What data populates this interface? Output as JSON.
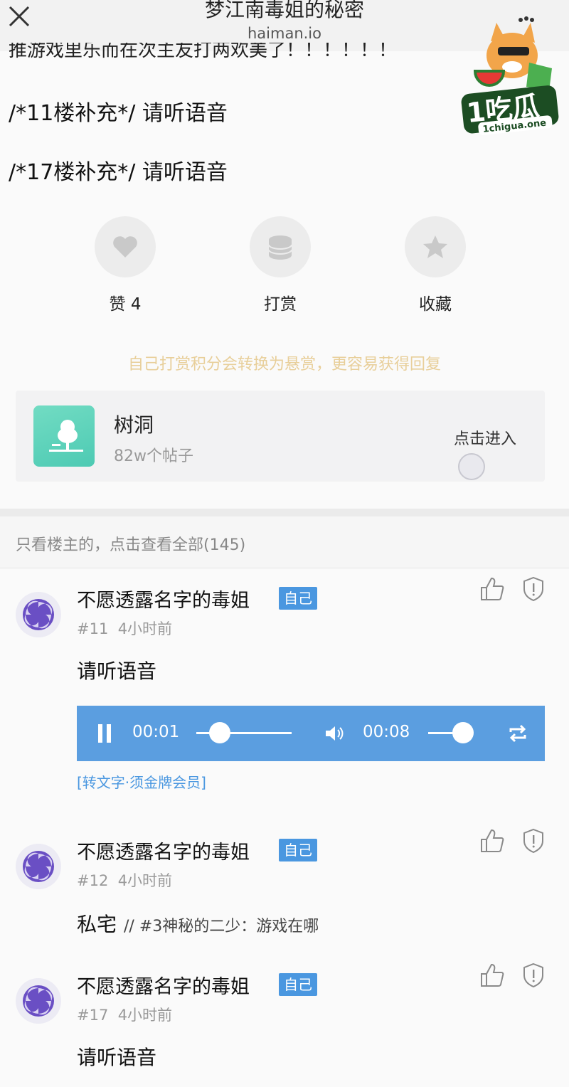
{
  "header": {
    "title": "梦江南毒姐的秘密",
    "domain": "haiman.io",
    "cut_text": "推游戏里乐而在次主友打两欢美了！！！！！！"
  },
  "watermark": {
    "brand": "1吃瓜",
    "site": "1chigua.one"
  },
  "body_lines": [
    "/*11楼补充*/ 请听语音",
    "/*17楼补充*/ 请听语音"
  ],
  "actions": [
    {
      "label": "赞 4",
      "icon": "heart-icon"
    },
    {
      "label": "打赏",
      "icon": "coin-stack-icon"
    },
    {
      "label": "收藏",
      "icon": "star-icon"
    }
  ],
  "reward_hint": "自己打赏积分会转换为悬赏，更容易获得回复",
  "forum_card": {
    "name": "树洞",
    "post_count": "82w个帖子",
    "enter_label": "点击进入",
    "icon": "tree-icon"
  },
  "filter": {
    "text": "只看楼主的，点击查看全部(145)"
  },
  "posts": [
    {
      "username": "不愿透露名字的毒姐",
      "badge": "自己",
      "floor": "#11",
      "time": "4小时前",
      "content": "请听语音",
      "audio": {
        "current": "00:01",
        "duration": "00:08",
        "progress": 0.125,
        "volume": 0.75
      },
      "transcribe_label": "[转文字·须金牌会员]"
    },
    {
      "username": "不愿透露名字的毒姐",
      "badge": "自己",
      "floor": "#12",
      "time": "4小时前",
      "content": "私宅",
      "quote": "// #3神秘的二少：游戏在哪"
    },
    {
      "username": "不愿透露名字的毒姐",
      "badge": "自己",
      "floor": "#17",
      "time": "4小时前",
      "content": "请听语音"
    }
  ],
  "colors": {
    "accent": "#4a97e0",
    "audio_bar": "#5b9ee0",
    "hint": "#e8cf9a",
    "card_icon": "#5ed3bb"
  }
}
